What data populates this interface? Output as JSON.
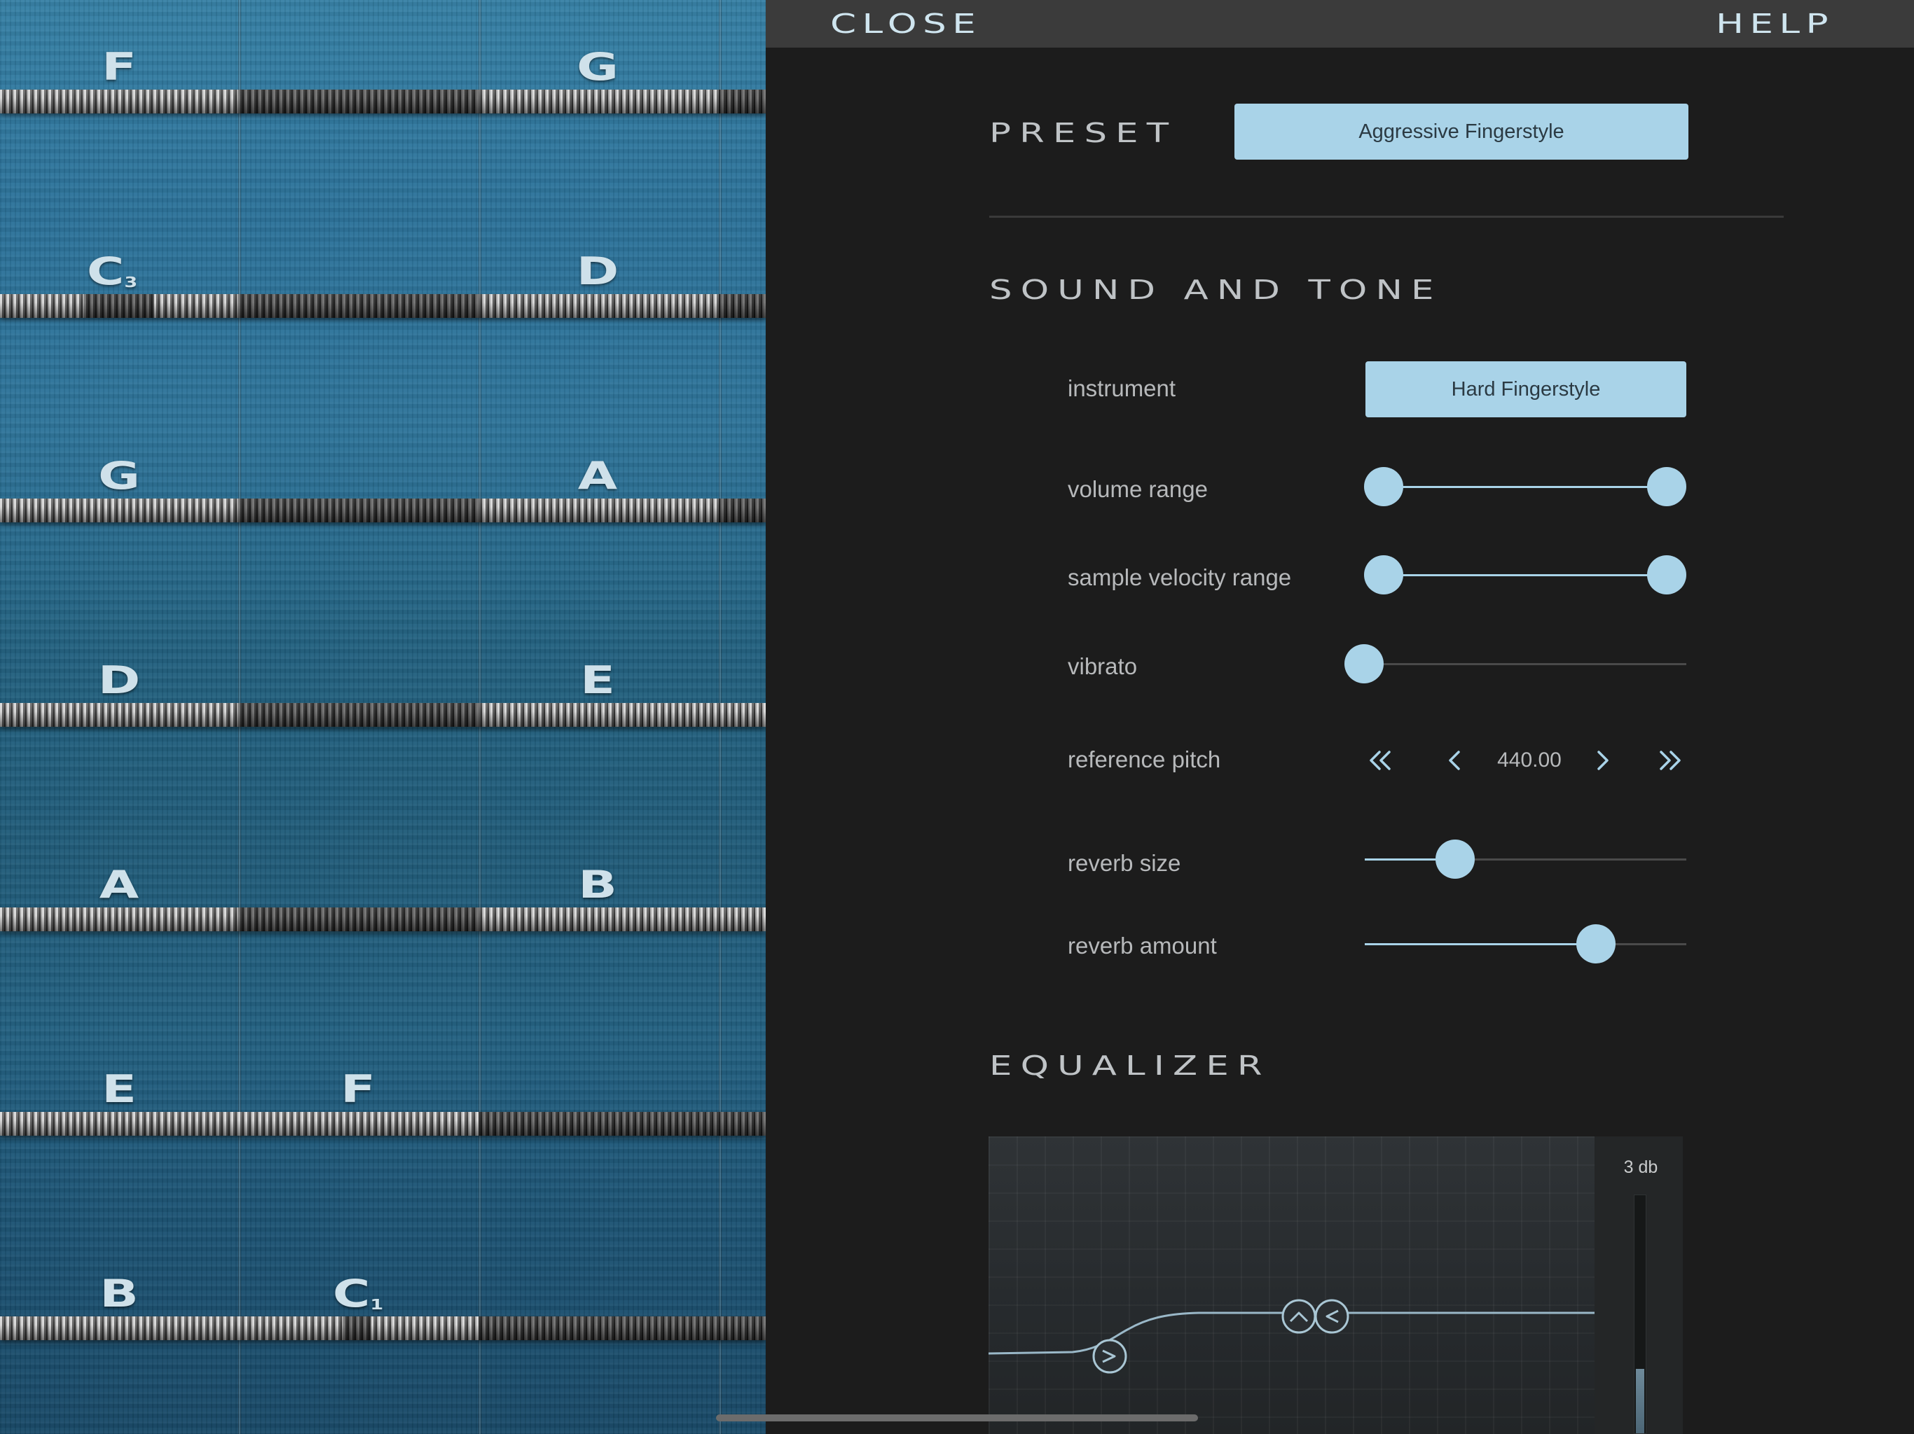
{
  "topbar": {
    "close_label": "CLOSE",
    "help_label": "HELP"
  },
  "preset": {
    "title": "PRESET",
    "value": "Aggressive Fingerstyle"
  },
  "sound_and_tone": {
    "title": "SOUND AND TONE",
    "instrument": {
      "label": "instrument",
      "value": "Hard Fingerstyle"
    },
    "volume_range": {
      "label": "volume range",
      "low": 0.0,
      "high": 1.0
    },
    "sample_velocity_range": {
      "label": "sample velocity range",
      "low": 0.0,
      "high": 1.0
    },
    "vibrato": {
      "label": "vibrato",
      "value": 0.0
    },
    "reference_pitch": {
      "label": "reference pitch",
      "value": "440.00"
    },
    "reverb_size": {
      "label": "reverb size",
      "value": 0.28
    },
    "reverb_amount": {
      "label": "reverb amount",
      "value": 0.72
    }
  },
  "equalizer": {
    "title": "EQUALIZER",
    "gain_label": "3 db",
    "meter_level": 0.27
  },
  "fretboard": {
    "rows": [
      {
        "left": "F",
        "right": "G"
      },
      {
        "left": "C",
        "left_sub": "3",
        "right": "D"
      },
      {
        "left": "G",
        "right": "A"
      },
      {
        "left": "D",
        "right": "E"
      },
      {
        "left": "A",
        "right": "B"
      },
      {
        "left": "E",
        "right": "F"
      },
      {
        "left": "B",
        "right": "C",
        "right_sub": "1"
      }
    ]
  },
  "colors": {
    "accent": "#a9d3e8",
    "panel_bg": "#1c1c1c",
    "topbar_bg": "#3b3b3b",
    "fretboard": "#2a7199"
  }
}
